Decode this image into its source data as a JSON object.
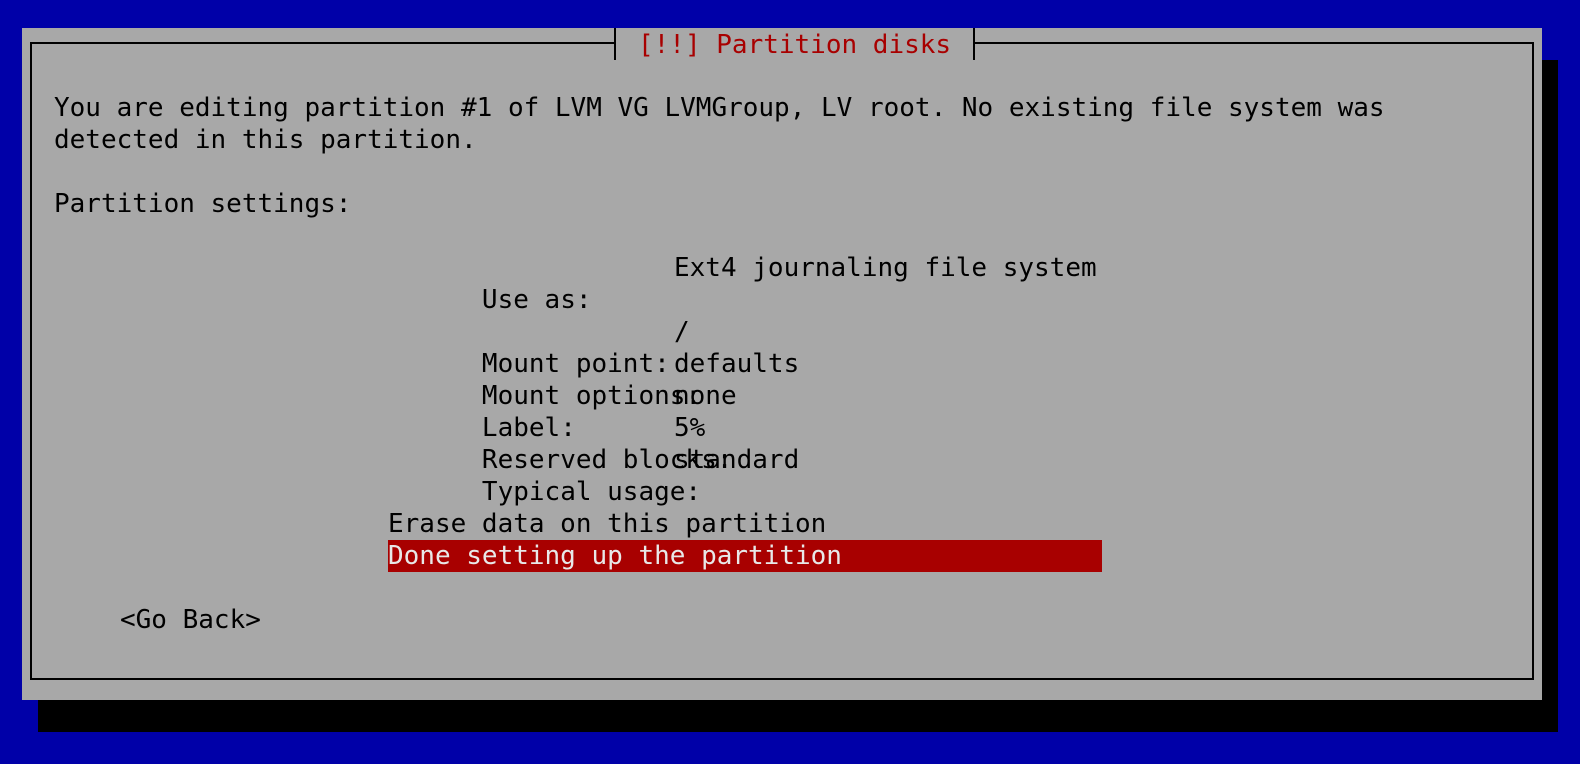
{
  "dialog": {
    "title": "[!!] Partition disks",
    "description_line1": "You are editing partition #1 of LVM VG LVMGroup, LV root. No existing file system was",
    "description_line2": "detected in this partition.",
    "settings_heading": "Partition settings:"
  },
  "settings": [
    {
      "label": "Use as:",
      "value": "Ext4 journaling file system"
    },
    {
      "label": "Mount point:",
      "value": "/"
    },
    {
      "label": "Mount options:",
      "value": "defaults"
    },
    {
      "label": "Label:",
      "value": "none"
    },
    {
      "label": "Reserved blocks:",
      "value": "5%"
    },
    {
      "label": "Typical usage:",
      "value": "standard"
    }
  ],
  "actions": {
    "erase": "Erase data on this partition",
    "done": "Done setting up the partition"
  },
  "buttons": {
    "go_back": "<Go Back>"
  },
  "colors": {
    "background": "#0000a8",
    "dialog": "#a8a8a8",
    "title": "#a80000",
    "highlight": "#a80000"
  }
}
